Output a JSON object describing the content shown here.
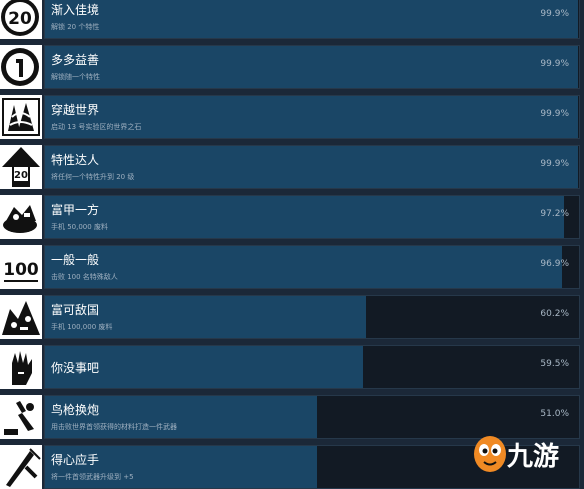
{
  "achievements": [
    {
      "title": "渐入佳境",
      "desc": "解锁 20 个特性",
      "pct": "99.9%",
      "fill": 0.999,
      "icon": "badge-20-icon"
    },
    {
      "title": "多多益善",
      "desc": "解锁随一个特性",
      "pct": "99.9%",
      "fill": 0.999,
      "icon": "badge-1-icon"
    },
    {
      "title": "穿越世界",
      "desc": "启动 13 号实验区的世界之石",
      "pct": "99.9%",
      "fill": 0.999,
      "icon": "world-stone-icon"
    },
    {
      "title": "特性达人",
      "desc": "将任何一个特性升到 20 级",
      "pct": "99.9%",
      "fill": 0.999,
      "icon": "arrow-20-icon"
    },
    {
      "title": "富甲一方",
      "desc": "手机 50,000 废料",
      "pct": "97.2%",
      "fill": 0.972,
      "icon": "junk-pile-icon"
    },
    {
      "title": "一般一般",
      "desc": "击败 100 名特殊敌人",
      "pct": "96.9%",
      "fill": 0.969,
      "icon": "badge-100-icon"
    },
    {
      "title": "富可敌国",
      "desc": "手机 100,000 废料",
      "pct": "60.2%",
      "fill": 0.602,
      "icon": "junk-mountain-icon"
    },
    {
      "title": "你没事吧",
      "desc": "",
      "pct": "59.5%",
      "fill": 0.595,
      "icon": "hand-icon"
    },
    {
      "title": "鸟枪换炮",
      "desc": "用击败世界首领获得的材料打造一件武器",
      "pct": "51.0%",
      "fill": 0.51,
      "icon": "forge-icon"
    },
    {
      "title": "得心应手",
      "desc": "将一件首领武器升级到 +5",
      "pct": "",
      "fill": 0.51,
      "icon": "weapon-upgrade-icon"
    }
  ],
  "watermark": {
    "text": "九游",
    "icon": "nine-game-mascot-icon"
  }
}
